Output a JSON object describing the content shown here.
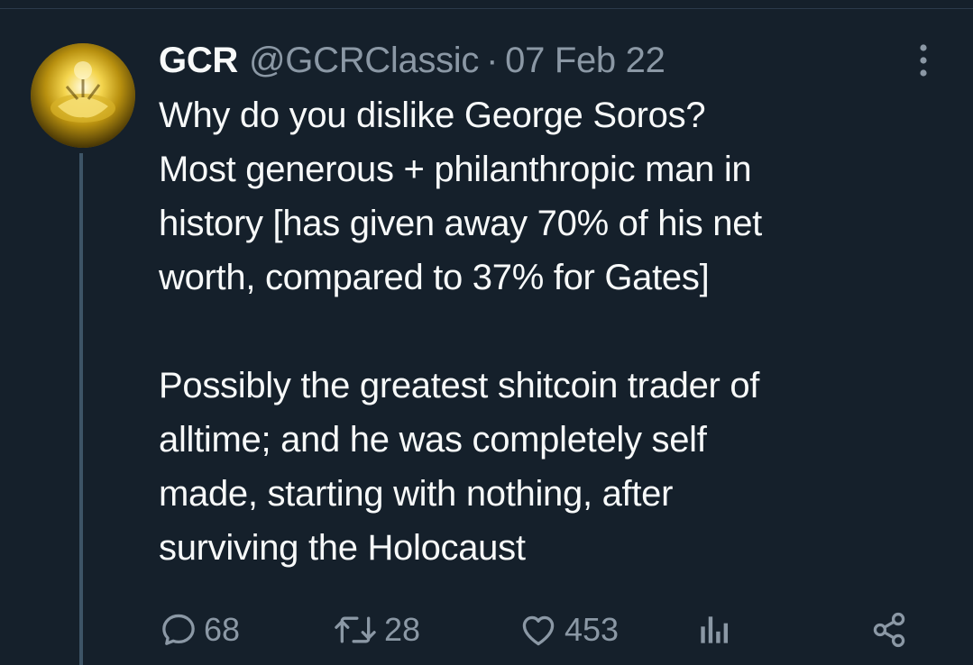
{
  "tweet": {
    "display_name": "GCR",
    "handle": "@GCRClassic",
    "separator": "·",
    "date": "07 Feb 22",
    "text": "Why do you dislike George Soros?\nMost generous + philanthropic man in\nhistory [has given away 70% of his net\nworth, compared to 37% for Gates]\n\nPossibly the greatest shitcoin trader of\nalltime; and he was completely self\nmade, starting with nothing, after\nsurviving the Holocaust"
  },
  "actions": {
    "replies": "68",
    "retweets": "28",
    "likes": "453"
  },
  "icons": {
    "more": "more-vertical-icon",
    "reply": "reply-icon",
    "retweet": "retweet-icon",
    "like": "heart-icon",
    "views": "views-bar-chart-icon",
    "share": "share-icon"
  },
  "colors": {
    "background": "#15202b",
    "text": "#f7f9f9",
    "secondary_text": "#8b98a5",
    "thread_line": "#3d5466"
  }
}
